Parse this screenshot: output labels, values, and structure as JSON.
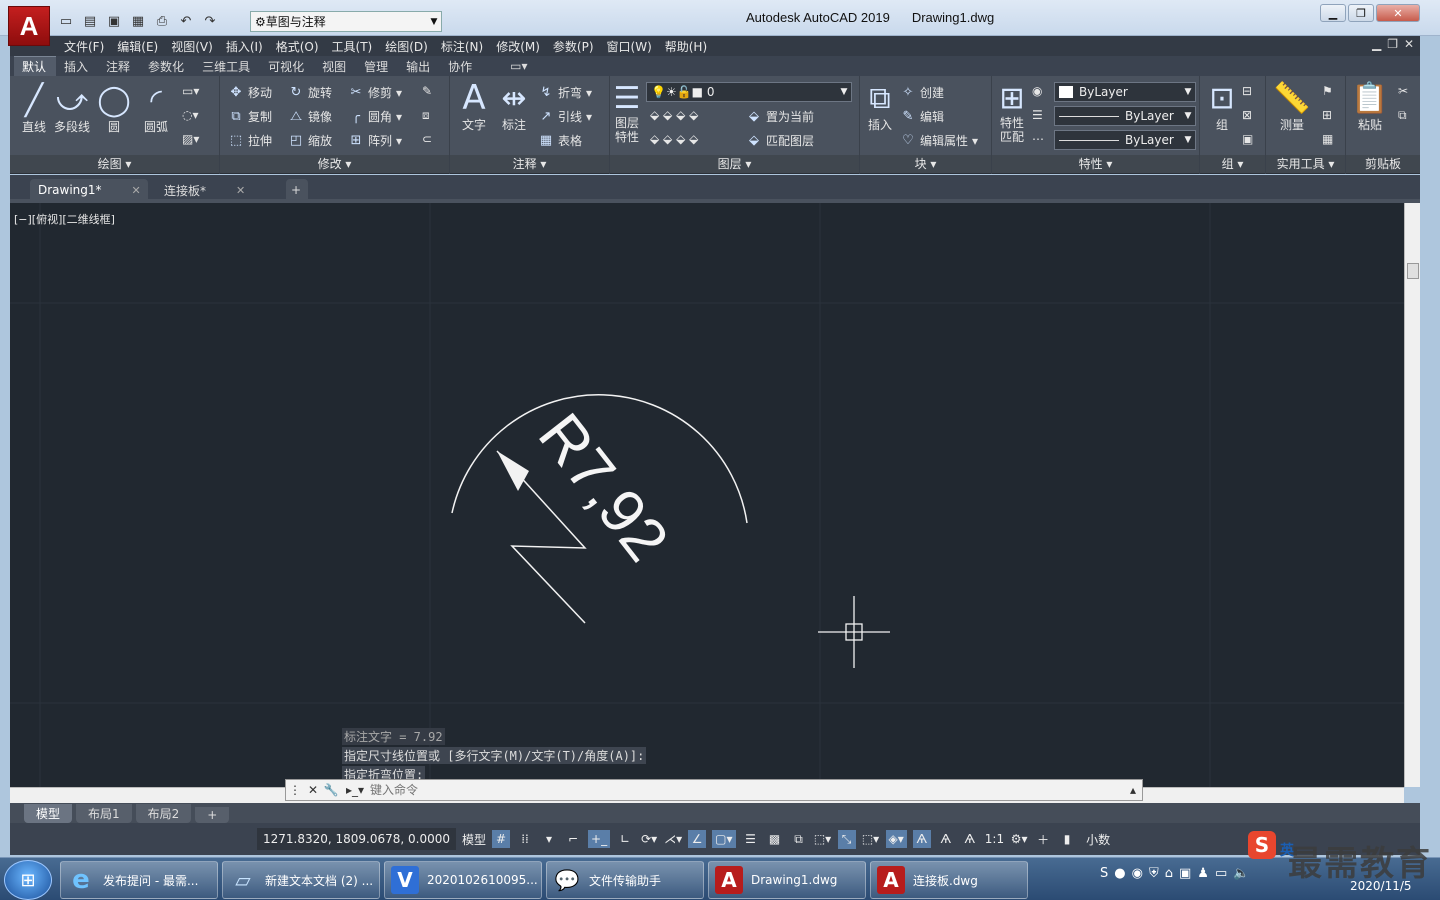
{
  "app": {
    "logo": "A",
    "title": "Autodesk AutoCAD 2019",
    "file": "Drawing1.dwg",
    "workspace": "草图与注释"
  },
  "menu": [
    "文件(F)",
    "编辑(E)",
    "视图(V)",
    "插入(I)",
    "格式(O)",
    "工具(T)",
    "绘图(D)",
    "标注(N)",
    "修改(M)",
    "参数(P)",
    "窗口(W)",
    "帮助(H)"
  ],
  "ribbon_tabs": [
    "默认",
    "插入",
    "注释",
    "参数化",
    "三维工具",
    "可视化",
    "视图",
    "管理",
    "输出",
    "协作"
  ],
  "ribbon": {
    "draw": {
      "title": "绘图",
      "line": "直线",
      "polyline": "多段线",
      "circle": "圆",
      "arc": "圆弧"
    },
    "modify": {
      "title": "修改",
      "move": "移动",
      "rotate": "旋转",
      "trim": "修剪",
      "copy": "复制",
      "mirror": "镜像",
      "fillet": "圆角",
      "stretch": "拉伸",
      "scale": "缩放",
      "array": "阵列"
    },
    "annotation": {
      "title": "注释",
      "text": "文字",
      "dimension": "标注",
      "jog": "折弯",
      "leader": "引线",
      "table": "表格"
    },
    "layers": {
      "title": "图层",
      "layer_props": "图层特性",
      "current_layer": "0",
      "set_current": "置为当前",
      "match_layer": "匹配图层"
    },
    "block": {
      "title": "块",
      "insert": "插入",
      "create": "创建",
      "edit": "编辑",
      "edit_attr": "编辑属性"
    },
    "properties": {
      "title": "特性",
      "match": "特性匹配",
      "color": "ByLayer",
      "linetype": "ByLayer",
      "lineweight": "ByLayer"
    },
    "groups": {
      "title": "组",
      "group": "组"
    },
    "utilities": {
      "title": "实用工具",
      "measure": "测量"
    },
    "clipboard": {
      "title": "剪贴板",
      "paste": "粘贴"
    }
  },
  "doc_tabs": [
    "Drawing1*",
    "连接板*"
  ],
  "viewport_label": "[−][俯视][二维线框]",
  "drawing": {
    "dimension_text": "R7,92"
  },
  "command_history": [
    "标注文字 = 7.92",
    "指定尺寸线位置或 [多行文字(M)/文字(T)/角度(A)]:",
    "指定折弯位置:"
  ],
  "command_placeholder": "键入命令",
  "layout_tabs": [
    "模型",
    "布局1",
    "布局2"
  ],
  "status": {
    "coords": "1271.8320, 1809.0678, 0.0000",
    "model": "模型",
    "scale": "1:1",
    "units": "小数"
  },
  "taskbar": [
    {
      "label": "发布提问 - 最需..."
    },
    {
      "label": "新建文本文档 (2) ..."
    },
    {
      "label": "2020102610095..."
    },
    {
      "label": "文件传输助手"
    },
    {
      "label": "Drawing1.dwg"
    },
    {
      "label": "连接板.dwg"
    }
  ],
  "tray": {
    "ime": "英",
    "date": "2020/11/5"
  },
  "watermark": "最需教育",
  "colors": {
    "canvas": "#212830",
    "ribbon": "#4a525e",
    "taskbar": "#2b4b73",
    "accent": "#c41f1f"
  }
}
